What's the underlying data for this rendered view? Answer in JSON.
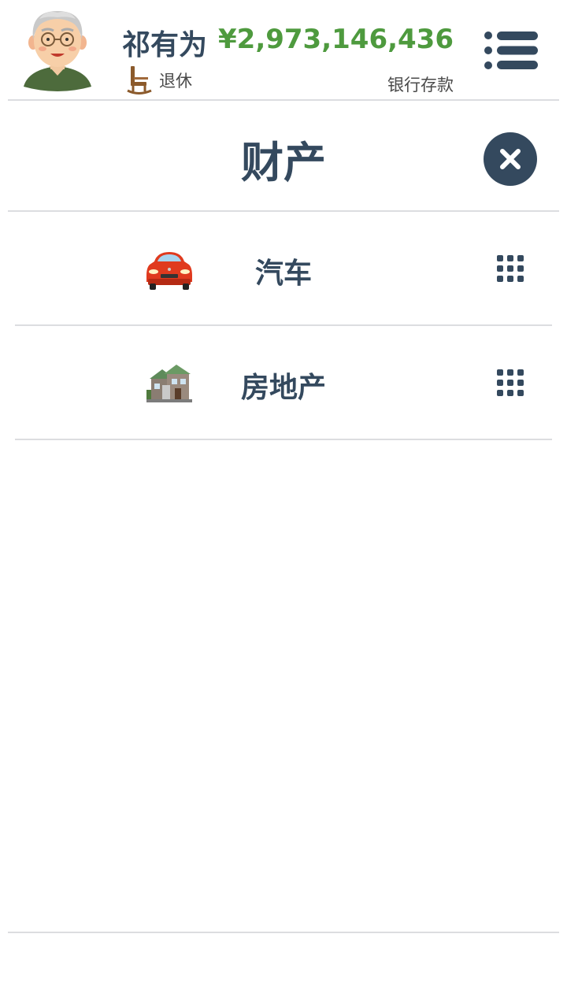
{
  "header": {
    "name": "祁有为",
    "status": "退休",
    "balance": "¥2,973,146,436",
    "balance_label": "银行存款"
  },
  "panel": {
    "title": "财产"
  },
  "assets": [
    {
      "label": "汽车",
      "icon": "car-icon"
    },
    {
      "label": "房地产",
      "icon": "house-icon"
    }
  ],
  "colors": {
    "primary": "#34495e",
    "money": "#4e9a3e",
    "divider": "#dcdde0"
  }
}
